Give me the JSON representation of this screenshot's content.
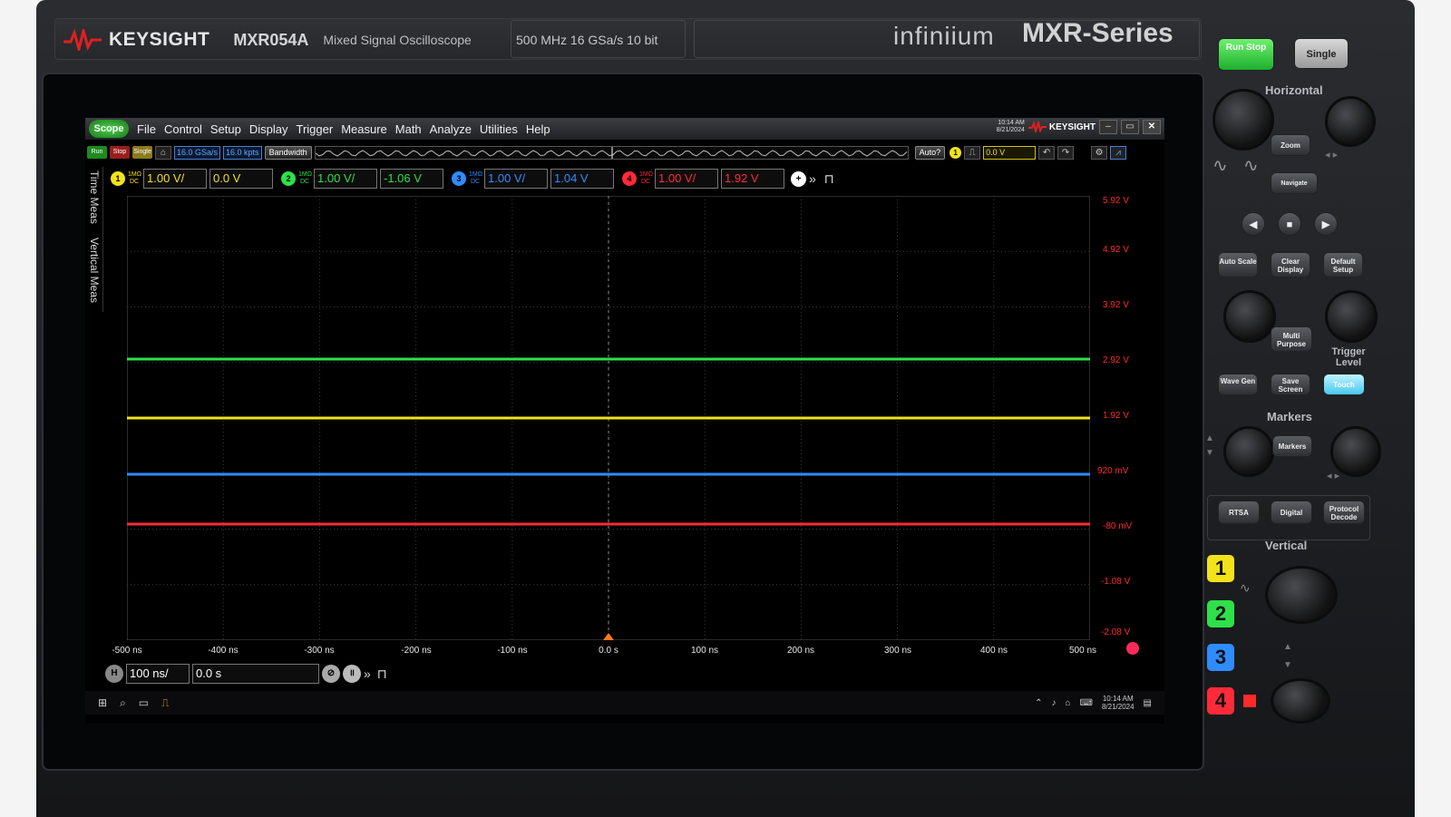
{
  "instrument": {
    "maker": "KEYSIGHT",
    "model": "MXR054A",
    "description": "Mixed Signal Oscilloscope",
    "specs": "500 MHz  16 GSa/s  10 bit",
    "family": "infiniium",
    "series": "MXR-Series"
  },
  "menu": {
    "scope_label": "Scope",
    "items": [
      "File",
      "Control",
      "Setup",
      "Display",
      "Trigger",
      "Measure",
      "Math",
      "Analyze",
      "Utilities",
      "Help"
    ],
    "time": "10:14 AM",
    "date": "8/21/2024",
    "brand_small": "KEYSIGHT"
  },
  "toolbar": {
    "run_label": "Run",
    "stop_label": "Stop",
    "single_label": "Single",
    "sample_rate": "16.0 GSa/s",
    "memory": "16.0 kpts",
    "bandwidth_label": "Bandwidth",
    "auto_label": "Auto?",
    "trigger_level": "0.0 V"
  },
  "channels": [
    {
      "num": "1",
      "coupling": "1MΩ DC",
      "scale": "1.00 V/",
      "offset": "0.0 V",
      "color": "#f2e21a"
    },
    {
      "num": "2",
      "coupling": "1MΩ DC",
      "scale": "1.00 V/",
      "offset": "-1.06 V",
      "color": "#2ee04a"
    },
    {
      "num": "3",
      "coupling": "1MΩ DC",
      "scale": "1.00 V/",
      "offset": "1.04 V",
      "color": "#2f8cff"
    },
    {
      "num": "4",
      "coupling": "1MΩ DC",
      "scale": "1.00 V/",
      "offset": "1.92 V",
      "color": "#ff2a3a"
    }
  ],
  "side_tabs": [
    "Time Meas",
    "Vertical Meas"
  ],
  "graticule": {
    "y_labels": [
      "5.92 V",
      "4.92 V",
      "3.92 V",
      "2.92 V",
      "1.92 V",
      "920 mV",
      "-80 mV",
      "-1.08 V",
      "-2.08 V"
    ],
    "x_labels": [
      "-500 ns",
      "-400 ns",
      "-300 ns",
      "-200 ns",
      "-100 ns",
      "0.0 s",
      "100 ns",
      "200 ns",
      "300 ns",
      "400 ns",
      "500 ns"
    ]
  },
  "timebase": {
    "scale": "100 ns/",
    "delay": "0.0 s"
  },
  "taskbar": {
    "time": "10:14 AM",
    "date": "8/21/2024"
  },
  "panel": {
    "run_stop": "Run Stop",
    "single": "Single",
    "horizontal_label": "Horizontal",
    "zoom": "Zoom",
    "navigate": "Navigate",
    "auto_scale": "Auto Scale",
    "clear_display": "Clear Display",
    "default_setup": "Default Setup",
    "multi_purpose": "Multi Purpose",
    "trigger_level": "Trigger Level",
    "wave_gen": "Wave Gen",
    "save_screen": "Save Screen",
    "touch": "Touch",
    "markers_label": "Markers",
    "markers_btn": "Markers",
    "rtsa": "RTSA",
    "digital": "Digital",
    "protocol_decode": "Protocol Decode",
    "vertical_label": "Vertical",
    "channel_keys": [
      "1",
      "2",
      "3",
      "4"
    ]
  }
}
